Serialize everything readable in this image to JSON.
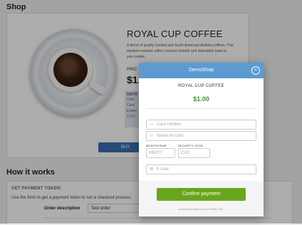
{
  "shop": {
    "heading": "Shop",
    "product_title": "ROYAL CUP COFFEE",
    "product_description": "A blend of quality Central and South American Arabica coffees. This medium-roasted coffee conveys smooth and delectable taste to your palate.",
    "price_label": "PRIC",
    "price_value": "$1.",
    "instructions_title": "INSTR",
    "instructions_lines": [
      "Card",
      "Card",
      "Expire",
      "CVC/"
    ],
    "buy_label": "BUY"
  },
  "how": {
    "heading": "How it works",
    "subheading": "GET PAYMENT TOKEN:",
    "description": "Use the form to get a payment token to run a checkout process.",
    "order_label": "Order description",
    "order_value": "Test order"
  },
  "modal": {
    "title": "DemoShop",
    "close_glyph": "×",
    "product": "ROYAL CUP COFFEE",
    "price": "$1.00",
    "card_number_placeholder": "Card number",
    "name_placeholder": "Name on card",
    "month_year_label": "MONTH/YEAR",
    "security_code_label": "SECURITY CODE",
    "mmyy_placeholder": "MM/YY",
    "cvc_placeholder": "CVC",
    "email_placeholder": "E-mail",
    "confirm_label": "Confirm payment",
    "secured_text": "Secured payment by HOMIC INC",
    "colors": {
      "header": "#5b9bd1",
      "confirm": "#6aa51f",
      "price": "#3a9a2a"
    },
    "icons": {
      "card": "card-icon",
      "user": "user-icon",
      "email": "email-icon",
      "lock": "lock-icon"
    }
  }
}
